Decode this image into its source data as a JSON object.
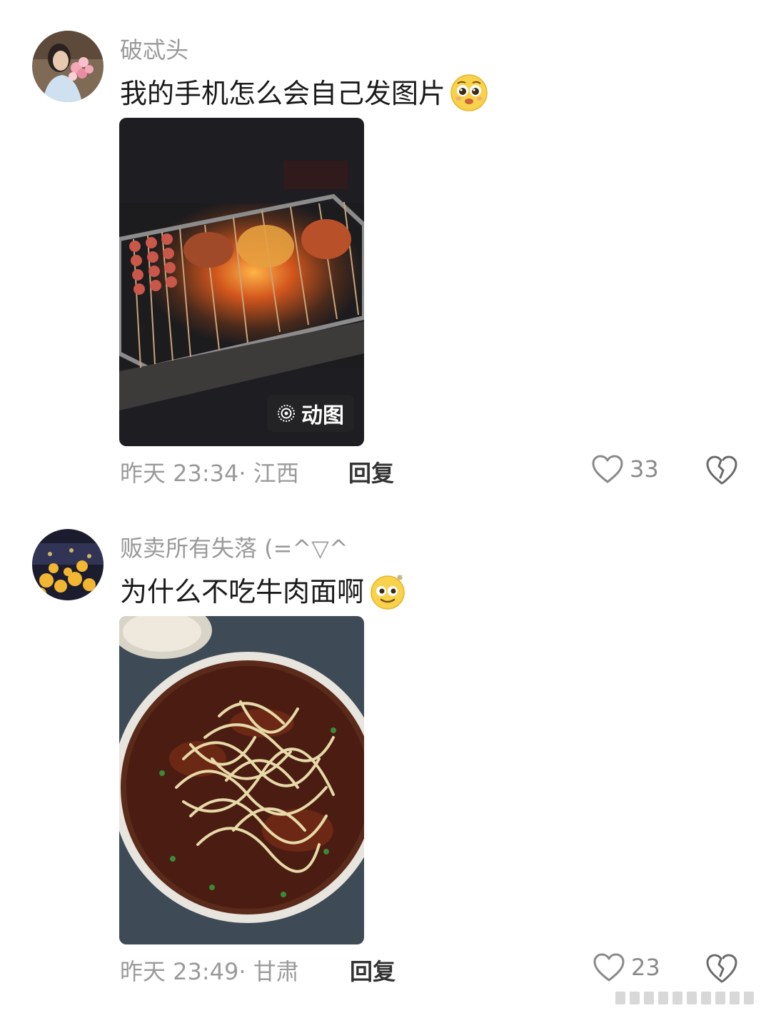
{
  "comments": [
    {
      "username": "破忒头",
      "text": "我的手机怎么会自己发图片",
      "emoji": "pleading-face",
      "photo_badge": "动图",
      "time": "昨天 23:34",
      "location": "江西",
      "reply_label": "回复",
      "likes": "33"
    },
    {
      "username": "贩卖所有失落 (=^▽^",
      "text": "为什么不吃牛肉面啊",
      "emoji": "dizzy-face",
      "time": "昨天 23:49",
      "location": "甘肃",
      "reply_label": "回复",
      "likes": "23"
    }
  ]
}
